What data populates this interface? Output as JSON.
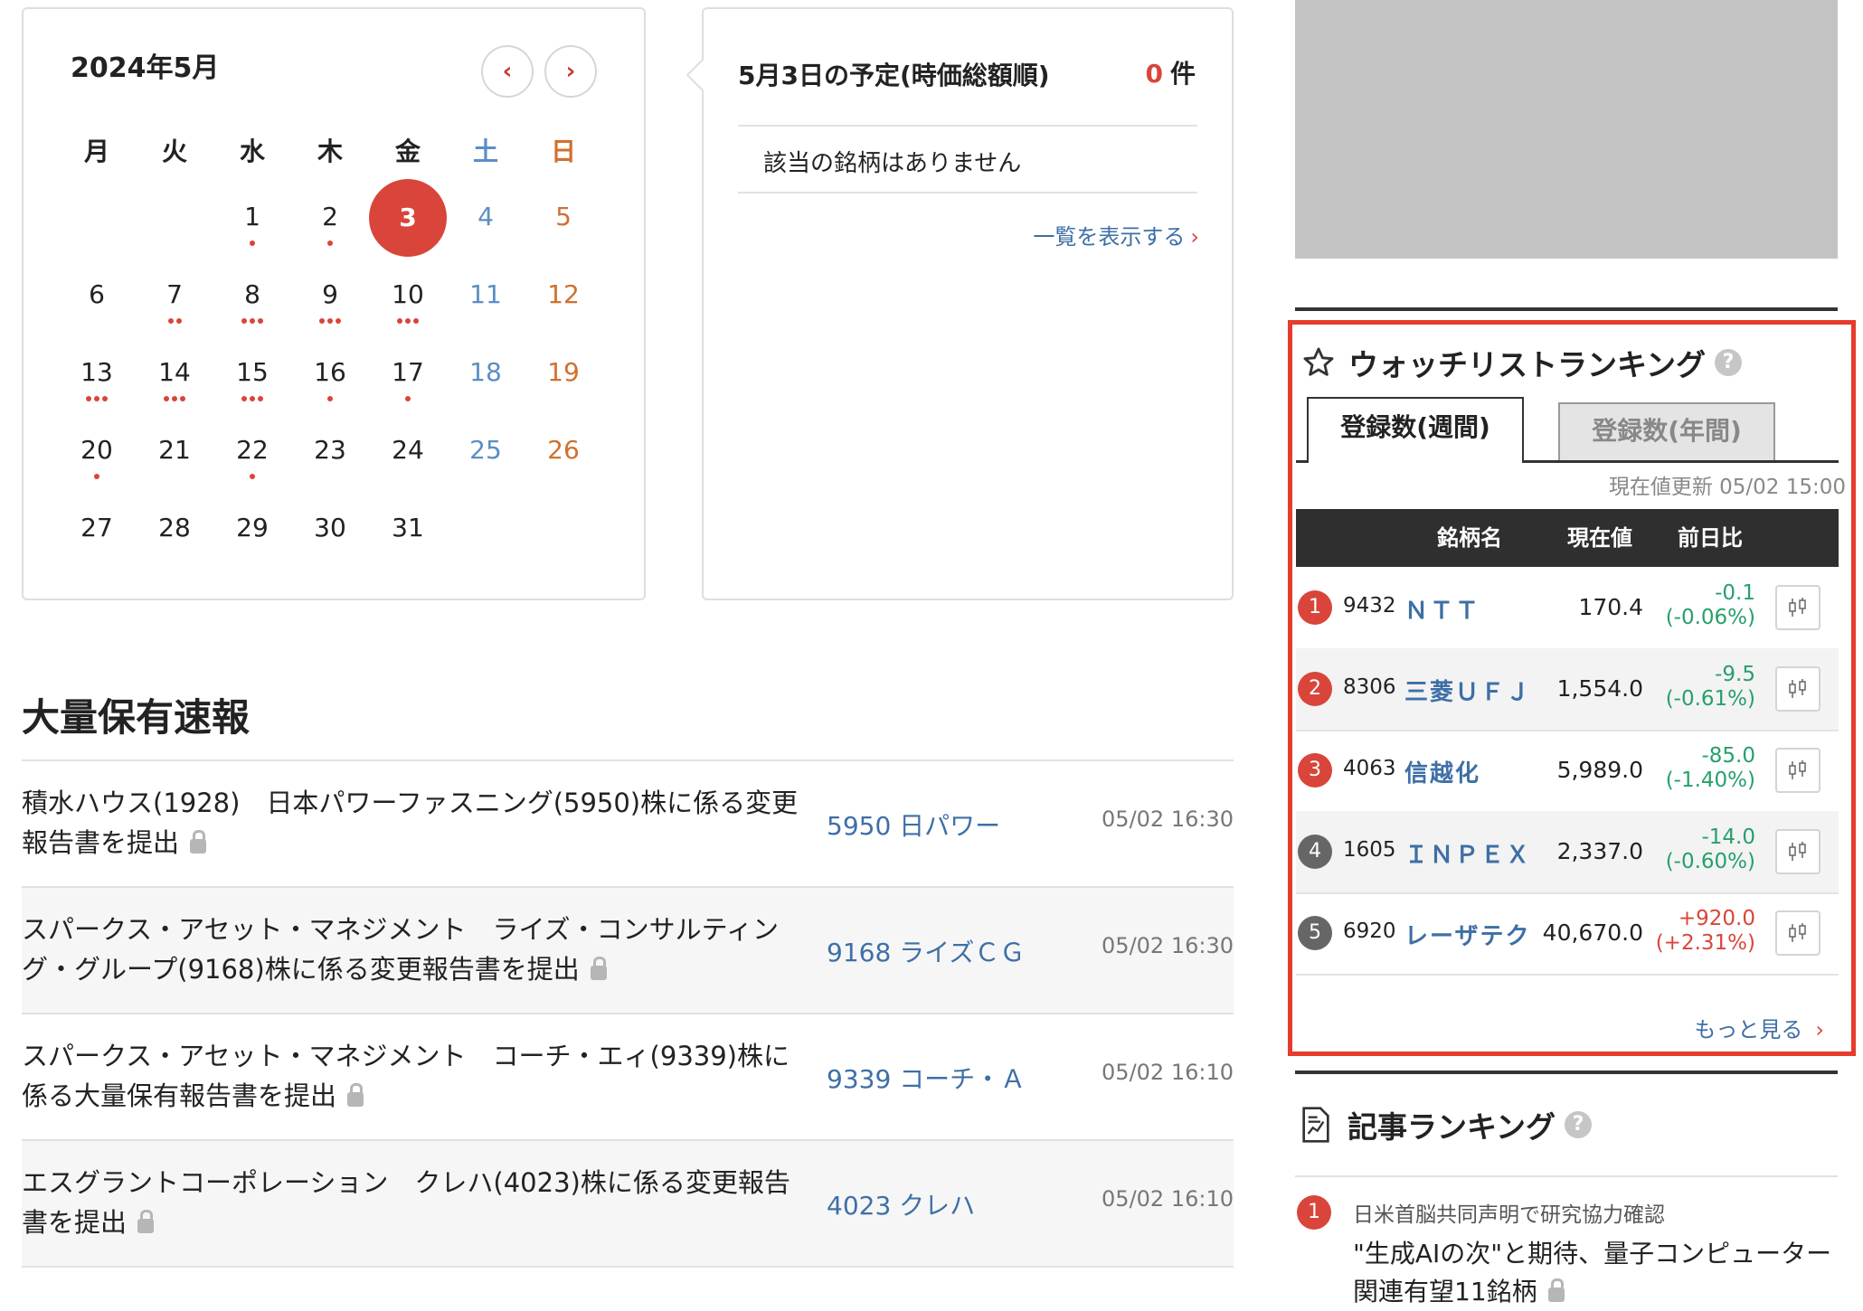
{
  "calendar": {
    "title": "2024年5月",
    "prev_label": "‹",
    "next_label": "›",
    "weekdays": [
      "月",
      "火",
      "水",
      "木",
      "金",
      "土",
      "日"
    ],
    "weeks": [
      [
        {
          "d": ""
        },
        {
          "d": ""
        },
        {
          "d": "1",
          "dots": 1
        },
        {
          "d": "2",
          "dots": 1
        },
        {
          "d": "3",
          "today": true
        },
        {
          "d": "4"
        },
        {
          "d": "5"
        }
      ],
      [
        {
          "d": "6"
        },
        {
          "d": "7",
          "dots": 2
        },
        {
          "d": "8",
          "dots": 3
        },
        {
          "d": "9",
          "dots": 3
        },
        {
          "d": "10",
          "dots": 3
        },
        {
          "d": "11"
        },
        {
          "d": "12"
        }
      ],
      [
        {
          "d": "13",
          "dots": 3
        },
        {
          "d": "14",
          "dots": 3
        },
        {
          "d": "15",
          "dots": 3
        },
        {
          "d": "16",
          "dots": 1
        },
        {
          "d": "17",
          "dots": 1
        },
        {
          "d": "18"
        },
        {
          "d": "19"
        }
      ],
      [
        {
          "d": "20",
          "dots": 1
        },
        {
          "d": "21"
        },
        {
          "d": "22",
          "dots": 1
        },
        {
          "d": "23"
        },
        {
          "d": "24"
        },
        {
          "d": "25"
        },
        {
          "d": "26"
        }
      ],
      [
        {
          "d": "27"
        },
        {
          "d": "28"
        },
        {
          "d": "29"
        },
        {
          "d": "30"
        },
        {
          "d": "31"
        },
        {
          "d": ""
        },
        {
          "d": ""
        }
      ]
    ]
  },
  "schedule": {
    "title": "5月3日の予定(時価総額順)",
    "count": "0",
    "count_unit": "件",
    "empty_text": "該当の銘柄はありません",
    "more_label": "一覧を表示する",
    "more_chevron": "›"
  },
  "holdings": {
    "title": "大量保有速報",
    "rows": [
      {
        "text": "積水ハウス(1928)　日本パワーファスニング(5950)株に係る変更報告書を提出",
        "link": "5950 日パワー",
        "time": "05/02 16:30"
      },
      {
        "text": "スパークス・アセット・マネジメント　ライズ・コンサルティング・グループ(9168)株に係る変更報告書を提出",
        "link": "9168 ライズＣＧ",
        "time": "05/02 16:30"
      },
      {
        "text": "スパークス・アセット・マネジメント　コーチ・エィ(9339)株に係る大量保有報告書を提出",
        "link": "9339 コーチ・Ａ",
        "time": "05/02 16:10"
      },
      {
        "text": "エスグラントコーポレーション　クレハ(4023)株に係る変更報告書を提出",
        "link": "4023 クレハ",
        "time": "05/02 16:10"
      }
    ]
  },
  "watchlist": {
    "title": "ウォッチリストランキング",
    "help": "?",
    "tab_weekly": "登録数(週間)",
    "tab_yearly": "登録数(年間)",
    "updated": "現在値更新 05/02 15:00",
    "col_name": "銘柄名",
    "col_price": "現在値",
    "col_change": "前日比",
    "rows": [
      {
        "rank": "1",
        "code": "9432",
        "name": "ＮＴＴ",
        "price": "170.4",
        "chg": "-0.1",
        "pct": "(-0.06%)",
        "dir": "down"
      },
      {
        "rank": "2",
        "code": "8306",
        "name": "三菱ＵＦＪ",
        "price": "1,554.0",
        "chg": "-9.5",
        "pct": "(-0.61%)",
        "dir": "down"
      },
      {
        "rank": "3",
        "code": "4063",
        "name": "信越化",
        "price": "5,989.0",
        "chg": "-85.0",
        "pct": "(-1.40%)",
        "dir": "down"
      },
      {
        "rank": "4",
        "code": "1605",
        "name": "ＩＮＰＥＸ",
        "price": "2,337.0",
        "chg": "-14.0",
        "pct": "(-0.60%)",
        "dir": "down"
      },
      {
        "rank": "5",
        "code": "6920",
        "name": "レーザテク",
        "price": "40,670.0",
        "chg": "+920.0",
        "pct": "(+2.31%)",
        "dir": "up"
      }
    ],
    "more_label": "もっと見る",
    "more_chevron": "›"
  },
  "articles": {
    "title": "記事ランキング",
    "help": "?",
    "first": {
      "rank": "1",
      "sub": "日米首脳共同声明で研究協力確認",
      "title": "\"生成AIの次\"と期待、量子コンピューター関連有望11銘柄"
    }
  },
  "colors": {
    "accent": "#d9453a",
    "link": "#3e6fa6",
    "highlight_border": "#e53c2c",
    "down": "#27a06a"
  }
}
